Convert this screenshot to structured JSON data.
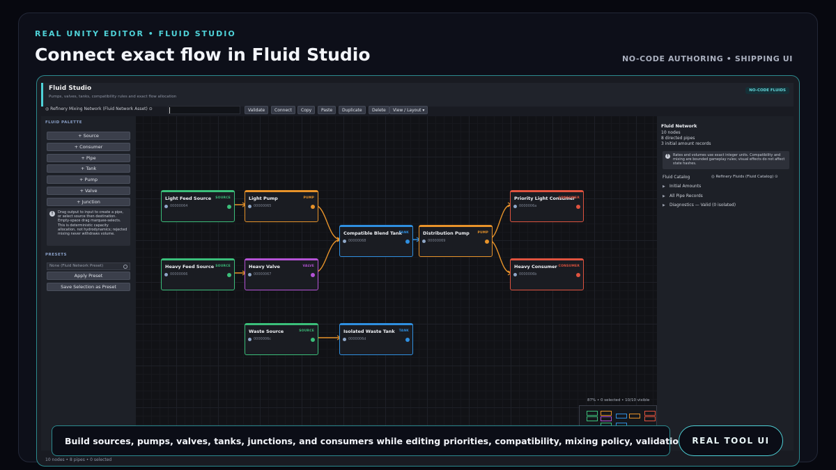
{
  "page": {
    "eyebrow": "REAL UNITY EDITOR • FLUID STUDIO",
    "headline": "Connect exact flow in Fluid Studio",
    "tagline_right": "NO-CODE AUTHORING • SHIPPING UI",
    "callout": "Build sources, pumps, valves, tanks, junctions, and consumers while editing priorities, compatibility, mixing policy, validation, and presets.",
    "cta_label": "REAL TOOL UI"
  },
  "editor": {
    "title": "Fluid Studio",
    "subtitle": "Pumps, valves, tanks, compatibility rules and exact flow allocation",
    "badge": "NO-CODE FLUIDS",
    "status_bar": "10 nodes • 8 pipes • 0 selected"
  },
  "toolbar": {
    "asset_field": "Refinery Mixing Network (Fluid Network Asset)",
    "buttons": [
      "Validate",
      "Connect",
      "Copy",
      "Paste",
      "Duplicate",
      "Delete",
      "View / Layout ▾"
    ]
  },
  "palette": {
    "heading": "FLUID PALETTE",
    "buttons": [
      "+ Source",
      "+ Consumer",
      "+ Pipe",
      "+ Tank",
      "+ Pump",
      "+ Valve",
      "+ Junction"
    ],
    "info": "Drag output to input to create a pipe, or select source then destination. Empty-space drag marquee-selects. This is deterministic capacity allocation, not hydrodynamics; rejected mixing never withdraws volume.",
    "presets_heading": "PRESETS",
    "preset_field": "None (Fluid Network Preset)",
    "apply_preset": "Apply Preset",
    "save_preset": "Save Selection as Preset"
  },
  "nodes": [
    {
      "title": "Light Feed Source",
      "type": "SOURCE",
      "id": "00000064",
      "color": "#3bbf7a"
    },
    {
      "title": "Light Pump",
      "type": "PUMP",
      "id": "00000065",
      "color": "#e8932a"
    },
    {
      "title": "Heavy Feed Source",
      "type": "SOURCE",
      "id": "00000066",
      "color": "#3bbf7a"
    },
    {
      "title": "Heavy Valve",
      "type": "VALVE",
      "id": "00000067",
      "color": "#b553d6"
    },
    {
      "title": "Compatible Blend Tank",
      "type": "TANK",
      "id": "00000068",
      "color": "#2f8fe0"
    },
    {
      "title": "Distribution Pump",
      "type": "PUMP",
      "id": "00000069",
      "color": "#e8932a"
    },
    {
      "title": "Priority Light Consumer",
      "type": "CONSUMER",
      "id": "0000006a",
      "color": "#e0533f"
    },
    {
      "title": "Heavy Consumer",
      "type": "CONSUMER",
      "id": "0000006b",
      "color": "#e0533f"
    },
    {
      "title": "Waste Source",
      "type": "SOURCE",
      "id": "0000006c",
      "color": "#3bbf7a"
    },
    {
      "title": "Isolated Waste Tank",
      "type": "TANK",
      "id": "0000006d",
      "color": "#2f8fe0"
    }
  ],
  "minimap": {
    "label": "87% • 0 selected • 10/10 visible"
  },
  "inspector": {
    "title": "Fluid Network",
    "nodes_count": "10 nodes",
    "pipes_count": "8 directed pipes",
    "records_count": "3 initial amount records",
    "note": "Rates and volumes use exact integer units. Compatibility and mixing are bounded gameplay rules; visual effects do not affect state hashes.",
    "catalog_label": "Fluid Catalog",
    "catalog_value": "Refinery Fluids (Fluid Catalog)",
    "foldouts": [
      "Initial Amounts",
      "All Pipe Records",
      "Diagnostics — Valid (0 isolated)"
    ]
  },
  "colors": {
    "accent": "#4fd2d8",
    "source": "#3bbf7a",
    "pump": "#e8932a",
    "valve": "#b553d6",
    "tank": "#2f8fe0",
    "consumer": "#e0533f"
  }
}
